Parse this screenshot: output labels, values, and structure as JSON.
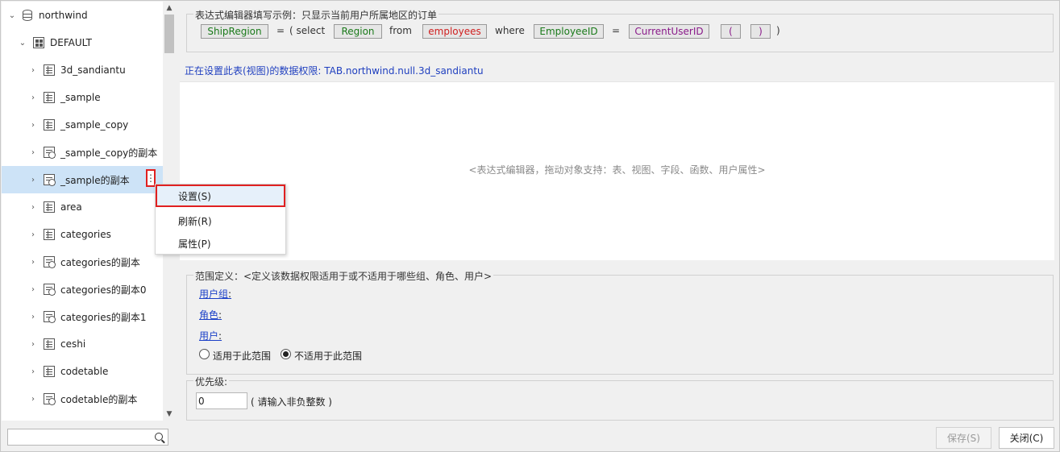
{
  "tree": {
    "root": {
      "label": "northwind",
      "icon": "database-icon"
    },
    "schema": {
      "label": "DEFAULT",
      "icon": "schema-icon"
    },
    "items": [
      {
        "label": "3d_sandiantu",
        "icon": "table-icon"
      },
      {
        "label": "_sample",
        "icon": "table-icon"
      },
      {
        "label": "_sample_copy",
        "icon": "table-icon"
      },
      {
        "label": "_sample_copy的副本",
        "icon": "view-icon"
      },
      {
        "label": "_sample的副本",
        "icon": "view-icon",
        "selected": true
      },
      {
        "label": "area",
        "icon": "table-icon"
      },
      {
        "label": "categories",
        "icon": "table-icon"
      },
      {
        "label": "categories的副本",
        "icon": "view-icon"
      },
      {
        "label": "categories的副本0",
        "icon": "view-icon"
      },
      {
        "label": "categories的副本1",
        "icon": "view-icon"
      },
      {
        "label": "ceshi",
        "icon": "table-icon"
      },
      {
        "label": "codetable",
        "icon": "table-icon"
      },
      {
        "label": "codetable的副本",
        "icon": "view-icon"
      }
    ],
    "more_glyph": "⋮"
  },
  "context_menu": {
    "items": [
      "设置(S)",
      "刷新(R)",
      "属性(P)"
    ],
    "highlighted_index": 0
  },
  "search": {
    "value": "",
    "placeholder": ""
  },
  "example": {
    "legend": "表达式编辑器填写示例：只显示当前用户所属地区的订单",
    "tokens": [
      "ShipRegion",
      "=",
      "( select",
      "Region",
      "from",
      "employees",
      "where",
      "EmployeeID",
      "=",
      "CurrentUserID",
      "(",
      ")",
      ")"
    ],
    "colors": {
      "field": "#1a7a1a",
      "table": "#d01f1f",
      "func": "#8a1a8a"
    }
  },
  "permission_line": "正在设置此表(视图)的数据权限: TAB.northwind.null.3d_sandiantu",
  "editor": {
    "placeholder": "<表达式编辑器，拖动对象支持：表、视图、字段、函数、用户属性>"
  },
  "scope": {
    "legend": "范围定义：<定义该数据权限适用于或不适用于哪些组、角色、用户>",
    "user_group": "用户组",
    "role": "角色",
    "user": "用户",
    "colon": ":",
    "radio_apply": "适用于此范围",
    "radio_not_apply": "不适用于此范围",
    "selected": "not_apply"
  },
  "priority": {
    "legend": "优先级:",
    "value": "0",
    "hint": "( 请输入非负整数 )"
  },
  "buttons": {
    "save": "保存(S)",
    "close": "关闭(C)"
  }
}
